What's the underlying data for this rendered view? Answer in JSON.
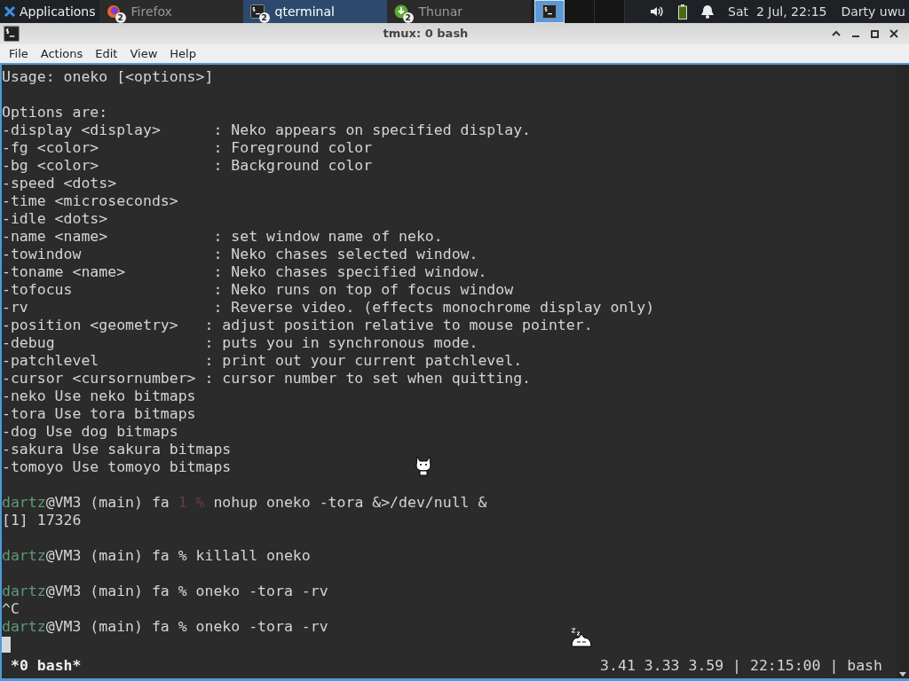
{
  "panel": {
    "apps_menu": "Applications",
    "tasks": [
      {
        "label": "Firefox",
        "count": "2",
        "kind": "browser",
        "selected": false
      },
      {
        "label": "qterminal",
        "count": "2",
        "kind": "terminal",
        "selected": true
      },
      {
        "label": "Thunar",
        "count": "2",
        "kind": "download",
        "selected": false
      }
    ],
    "workspaces": [
      {
        "selected": true
      },
      {
        "selected": false
      },
      {
        "selected": false
      }
    ],
    "clock": "Sat  2 Jul, 22:15",
    "user": "Darty uwu"
  },
  "window": {
    "title": "tmux: 0 bash",
    "menu": [
      "File",
      "Actions",
      "Edit",
      "View",
      "Help"
    ]
  },
  "terminal": {
    "lines": [
      {
        "kind": "plain",
        "text": "Usage: oneko [<options>]"
      },
      {
        "kind": "blank"
      },
      {
        "kind": "plain",
        "text": "Options are:"
      },
      {
        "kind": "plain",
        "text": "-display <display>      : Neko appears on specified display."
      },
      {
        "kind": "plain",
        "text": "-fg <color>             : Foreground color"
      },
      {
        "kind": "plain",
        "text": "-bg <color>             : Background color"
      },
      {
        "kind": "plain",
        "text": "-speed <dots>"
      },
      {
        "kind": "plain",
        "text": "-time <microseconds>"
      },
      {
        "kind": "plain",
        "text": "-idle <dots>"
      },
      {
        "kind": "plain",
        "text": "-name <name>            : set window name of neko."
      },
      {
        "kind": "plain",
        "text": "-towindow               : Neko chases selected window."
      },
      {
        "kind": "plain",
        "text": "-toname <name>          : Neko chases specified window."
      },
      {
        "kind": "plain",
        "text": "-tofocus                : Neko runs on top of focus window"
      },
      {
        "kind": "plain",
        "text": "-rv                     : Reverse video. (effects monochrome display only)"
      },
      {
        "kind": "plain",
        "text": "-position <geometry>   : adjust position relative to mouse pointer."
      },
      {
        "kind": "plain",
        "text": "-debug                 : puts you in synchronous mode."
      },
      {
        "kind": "plain",
        "text": "-patchlevel            : print out your current patchlevel."
      },
      {
        "kind": "plain",
        "text": "-cursor <cursornumber> : cursor number to set when quitting."
      },
      {
        "kind": "plain",
        "text": "-neko Use neko bitmaps"
      },
      {
        "kind": "plain",
        "text": "-tora Use tora bitmaps"
      },
      {
        "kind": "plain",
        "text": "-dog Use dog bitmaps"
      },
      {
        "kind": "plain",
        "text": "-sakura Use sakura bitmaps"
      },
      {
        "kind": "plain",
        "text": "-tomoyo Use tomoyo bitmaps"
      },
      {
        "kind": "blank"
      },
      {
        "kind": "prompt",
        "user": "dartz",
        "host": "@VM3 (main) fa",
        "status": "1",
        "symbol": "%",
        "command": "nohup oneko -tora &>/dev/null &"
      },
      {
        "kind": "plain",
        "text": "[1] 17326"
      },
      {
        "kind": "blank"
      },
      {
        "kind": "prompt",
        "user": "dartz",
        "host": "@VM3 (main) fa",
        "symbol": "%",
        "command": "killall oneko"
      },
      {
        "kind": "blank"
      },
      {
        "kind": "prompt",
        "user": "dartz",
        "host": "@VM3 (main) fa",
        "symbol": "%",
        "command": "oneko -tora -rv"
      },
      {
        "kind": "plain",
        "text": "^C"
      },
      {
        "kind": "prompt",
        "user": "dartz",
        "host": "@VM3 (main) fa",
        "symbol": "%",
        "command": "oneko -tora -rv"
      },
      {
        "kind": "cursor"
      }
    ],
    "status_left": "*0 bash*",
    "status_right": "3.41 3.33 3.59 | 22:15:00 | bash"
  }
}
